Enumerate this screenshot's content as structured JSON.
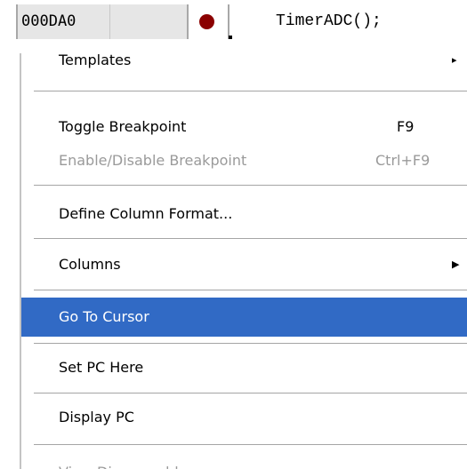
{
  "toolbar_row": {
    "address": "000DA0",
    "code": "TimerADC();"
  },
  "context_menu": {
    "items": [
      {
        "label": "Templates",
        "shortcut": "",
        "submenu": true,
        "enabled": true,
        "partially_visible": true
      },
      {
        "label": "Toggle Breakpoint",
        "shortcut": "F9",
        "submenu": false,
        "enabled": true
      },
      {
        "label": "Enable/Disable Breakpoint",
        "shortcut": "Ctrl+F9",
        "submenu": false,
        "enabled": false
      },
      {
        "label": "Define Column Format...",
        "shortcut": "",
        "submenu": false,
        "enabled": true
      },
      {
        "label": "Columns",
        "shortcut": "",
        "submenu": true,
        "enabled": true
      },
      {
        "label": "Go To Cursor",
        "shortcut": "",
        "submenu": false,
        "enabled": true,
        "selected": true
      },
      {
        "label": "Set PC Here",
        "shortcut": "",
        "submenu": false,
        "enabled": true
      },
      {
        "label": "Display PC",
        "shortcut": "",
        "submenu": false,
        "enabled": true
      },
      {
        "label": "View Disassembly",
        "shortcut": "",
        "submenu": false,
        "enabled": false,
        "partially_visible": true
      }
    ]
  },
  "colors": {
    "selection": "#316ac5",
    "disabled_text": "#9a9a9a",
    "breakpoint": "#8b0000"
  },
  "icons": {
    "breakpoint": "breakpoint-dot-icon",
    "submenu": "submenu-arrow-icon"
  }
}
